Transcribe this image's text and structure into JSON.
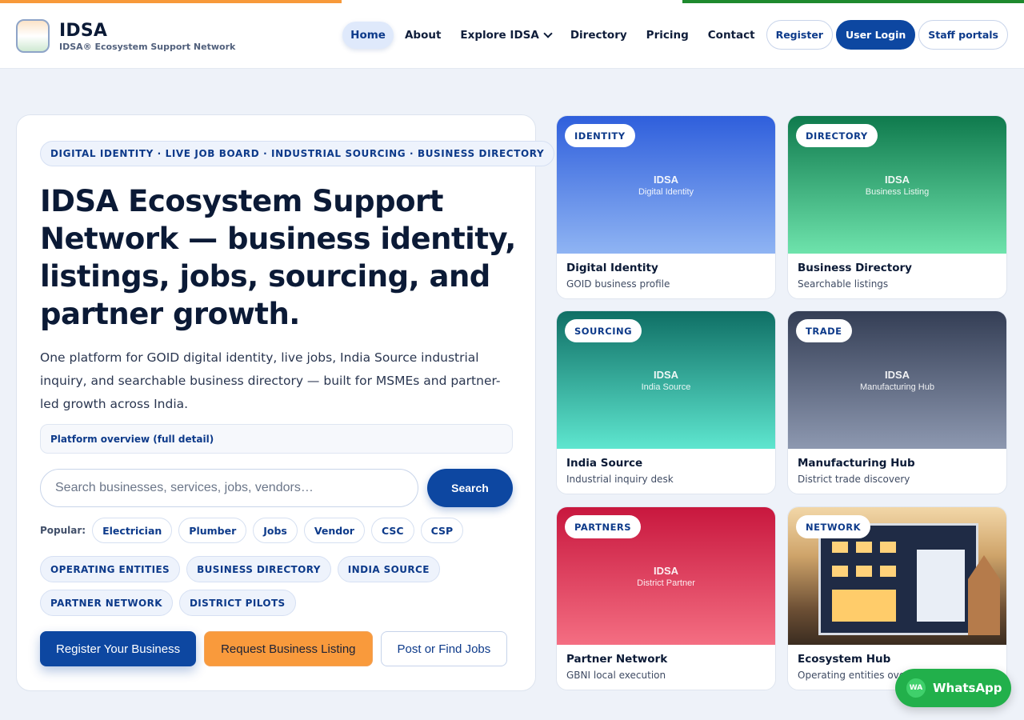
{
  "header": {
    "brand_title": "IDSA",
    "brand_subtitle": "IDSA® Ecosystem Support Network",
    "nav": {
      "home": "Home",
      "about": "About",
      "explore": "Explore IDSA",
      "directory": "Directory",
      "pricing": "Pricing",
      "contact": "Contact"
    },
    "register": "Register",
    "user_login": "User Login",
    "staff_portals": "Staff portals"
  },
  "hero": {
    "eyebrow": "DIGITAL IDENTITY · LIVE JOB BOARD · INDUSTRIAL SOURCING · BUSINESS DIRECTORY",
    "title": "IDSA Ecosystem Support Network — business identity, listings, jobs, sourcing, and partner growth.",
    "description": "One platform for GOID digital identity, live jobs, India Source industrial inquiry, and searchable business directory — built for MSMEs and partner-led growth across India.",
    "overview_link": "Platform overview (full detail)",
    "search_placeholder": "Search businesses, services, jobs, vendors…",
    "search_button": "Search",
    "popular_label": "Popular:",
    "popular": [
      "Electrician",
      "Plumber",
      "Jobs",
      "Vendor",
      "CSC",
      "CSP"
    ],
    "tags": [
      "OPERATING ENTITIES",
      "BUSINESS DIRECTORY",
      "INDIA SOURCE",
      "PARTNER NETWORK",
      "DISTRICT PILOTS"
    ],
    "cta": {
      "register": "Register Your Business",
      "request": "Request Business Listing",
      "jobs": "Post or Find Jobs"
    }
  },
  "cards": [
    {
      "badge": "IDENTITY",
      "media_title": "IDSA",
      "media_sub": "Digital Identity",
      "title": "Digital Identity",
      "sub": "GOID business profile"
    },
    {
      "badge": "DIRECTORY",
      "media_title": "IDSA",
      "media_sub": "Business Listing",
      "title": "Business Directory",
      "sub": "Searchable listings"
    },
    {
      "badge": "SOURCING",
      "media_title": "IDSA",
      "media_sub": "India Source",
      "title": "India Source",
      "sub": "Industrial inquiry desk"
    },
    {
      "badge": "TRADE",
      "media_title": "IDSA",
      "media_sub": "Manufacturing Hub",
      "title": "Manufacturing Hub",
      "sub": "District trade discovery"
    },
    {
      "badge": "PARTNERS",
      "media_title": "IDSA",
      "media_sub": "District Partner",
      "title": "Partner Network",
      "sub": "GBNI local execution"
    },
    {
      "badge": "NETWORK",
      "media_title": "",
      "media_sub": "",
      "title": "Ecosystem Hub",
      "sub": "Operating entities overview"
    }
  ],
  "whatsapp": {
    "icon_text": "WA",
    "label": "WhatsApp"
  },
  "colors": {
    "primary": "#0d47a1",
    "accent": "#f99a3c",
    "whatsapp": "#22b04b"
  }
}
